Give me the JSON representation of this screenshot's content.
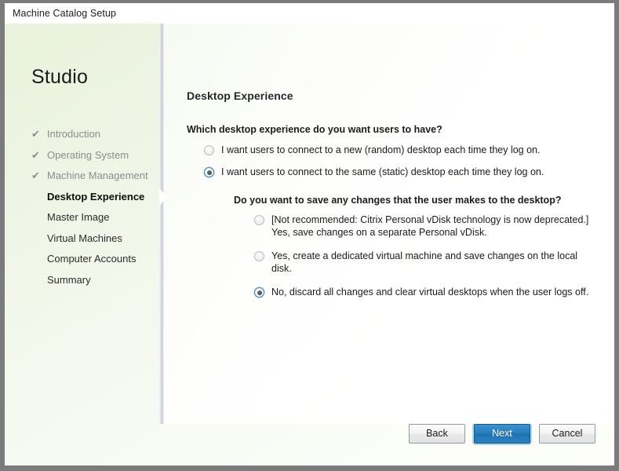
{
  "window": {
    "title": "Machine Catalog Setup"
  },
  "sidebar": {
    "brand": "Studio",
    "check_icon": "✔",
    "items": [
      {
        "label": "Introduction",
        "state": "done"
      },
      {
        "label": "Operating System",
        "state": "done"
      },
      {
        "label": "Machine Management",
        "state": "done"
      },
      {
        "label": "Desktop Experience",
        "state": "current"
      },
      {
        "label": "Master Image",
        "state": "upcoming"
      },
      {
        "label": "Virtual Machines",
        "state": "upcoming"
      },
      {
        "label": "Computer Accounts",
        "state": "upcoming"
      },
      {
        "label": "Summary",
        "state": "upcoming"
      }
    ]
  },
  "content": {
    "page_title": "Desktop Experience",
    "primary_question": "Which desktop experience do you want users to have?",
    "primary_options": [
      {
        "label": "I want users to connect to a new (random) desktop each time they log on.",
        "selected": false
      },
      {
        "label": "I want users to connect to the same (static) desktop each time they log on.",
        "selected": true
      }
    ],
    "sub_question": "Do you want to save any changes that the user makes to the desktop?",
    "sub_options": [
      {
        "label": "[Not recommended: Citrix Personal vDisk technology is now deprecated.]",
        "label_line2": "Yes, save changes on a separate Personal vDisk.",
        "selected": false
      },
      {
        "label": "Yes, create a dedicated virtual machine and save changes on the local disk.",
        "label_line2": "",
        "selected": false
      },
      {
        "label": "No, discard all changes and clear virtual desktops when the user logs off.",
        "label_line2": "",
        "selected": true
      }
    ]
  },
  "footer": {
    "back_label": "Back",
    "next_label": "Next",
    "cancel_label": "Cancel"
  },
  "colors": {
    "accent_blue": "#2a7fbd",
    "radio_ring": "#3d7fb5",
    "window_border": "#7b7b7b",
    "wash_green": "#e9f2dc"
  }
}
